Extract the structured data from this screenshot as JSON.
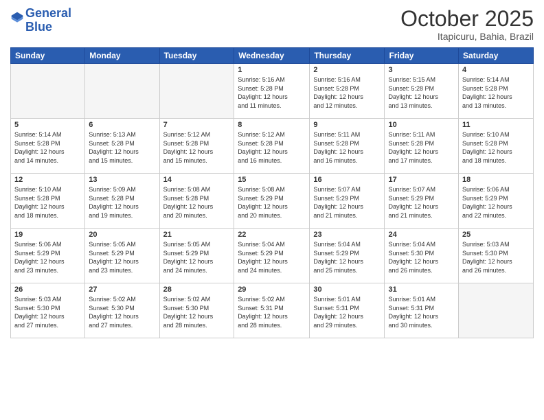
{
  "header": {
    "logo_line1": "General",
    "logo_line2": "Blue",
    "month_year": "October 2025",
    "location": "Itapicuru, Bahia, Brazil"
  },
  "weekdays": [
    "Sunday",
    "Monday",
    "Tuesday",
    "Wednesday",
    "Thursday",
    "Friday",
    "Saturday"
  ],
  "weeks": [
    [
      {
        "day": "",
        "text": ""
      },
      {
        "day": "",
        "text": ""
      },
      {
        "day": "",
        "text": ""
      },
      {
        "day": "1",
        "text": "Sunrise: 5:16 AM\nSunset: 5:28 PM\nDaylight: 12 hours\nand 11 minutes."
      },
      {
        "day": "2",
        "text": "Sunrise: 5:16 AM\nSunset: 5:28 PM\nDaylight: 12 hours\nand 12 minutes."
      },
      {
        "day": "3",
        "text": "Sunrise: 5:15 AM\nSunset: 5:28 PM\nDaylight: 12 hours\nand 13 minutes."
      },
      {
        "day": "4",
        "text": "Sunrise: 5:14 AM\nSunset: 5:28 PM\nDaylight: 12 hours\nand 13 minutes."
      }
    ],
    [
      {
        "day": "5",
        "text": "Sunrise: 5:14 AM\nSunset: 5:28 PM\nDaylight: 12 hours\nand 14 minutes."
      },
      {
        "day": "6",
        "text": "Sunrise: 5:13 AM\nSunset: 5:28 PM\nDaylight: 12 hours\nand 15 minutes."
      },
      {
        "day": "7",
        "text": "Sunrise: 5:12 AM\nSunset: 5:28 PM\nDaylight: 12 hours\nand 15 minutes."
      },
      {
        "day": "8",
        "text": "Sunrise: 5:12 AM\nSunset: 5:28 PM\nDaylight: 12 hours\nand 16 minutes."
      },
      {
        "day": "9",
        "text": "Sunrise: 5:11 AM\nSunset: 5:28 PM\nDaylight: 12 hours\nand 16 minutes."
      },
      {
        "day": "10",
        "text": "Sunrise: 5:11 AM\nSunset: 5:28 PM\nDaylight: 12 hours\nand 17 minutes."
      },
      {
        "day": "11",
        "text": "Sunrise: 5:10 AM\nSunset: 5:28 PM\nDaylight: 12 hours\nand 18 minutes."
      }
    ],
    [
      {
        "day": "12",
        "text": "Sunrise: 5:10 AM\nSunset: 5:28 PM\nDaylight: 12 hours\nand 18 minutes."
      },
      {
        "day": "13",
        "text": "Sunrise: 5:09 AM\nSunset: 5:28 PM\nDaylight: 12 hours\nand 19 minutes."
      },
      {
        "day": "14",
        "text": "Sunrise: 5:08 AM\nSunset: 5:28 PM\nDaylight: 12 hours\nand 20 minutes."
      },
      {
        "day": "15",
        "text": "Sunrise: 5:08 AM\nSunset: 5:29 PM\nDaylight: 12 hours\nand 20 minutes."
      },
      {
        "day": "16",
        "text": "Sunrise: 5:07 AM\nSunset: 5:29 PM\nDaylight: 12 hours\nand 21 minutes."
      },
      {
        "day": "17",
        "text": "Sunrise: 5:07 AM\nSunset: 5:29 PM\nDaylight: 12 hours\nand 21 minutes."
      },
      {
        "day": "18",
        "text": "Sunrise: 5:06 AM\nSunset: 5:29 PM\nDaylight: 12 hours\nand 22 minutes."
      }
    ],
    [
      {
        "day": "19",
        "text": "Sunrise: 5:06 AM\nSunset: 5:29 PM\nDaylight: 12 hours\nand 23 minutes."
      },
      {
        "day": "20",
        "text": "Sunrise: 5:05 AM\nSunset: 5:29 PM\nDaylight: 12 hours\nand 23 minutes."
      },
      {
        "day": "21",
        "text": "Sunrise: 5:05 AM\nSunset: 5:29 PM\nDaylight: 12 hours\nand 24 minutes."
      },
      {
        "day": "22",
        "text": "Sunrise: 5:04 AM\nSunset: 5:29 PM\nDaylight: 12 hours\nand 24 minutes."
      },
      {
        "day": "23",
        "text": "Sunrise: 5:04 AM\nSunset: 5:29 PM\nDaylight: 12 hours\nand 25 minutes."
      },
      {
        "day": "24",
        "text": "Sunrise: 5:04 AM\nSunset: 5:30 PM\nDaylight: 12 hours\nand 26 minutes."
      },
      {
        "day": "25",
        "text": "Sunrise: 5:03 AM\nSunset: 5:30 PM\nDaylight: 12 hours\nand 26 minutes."
      }
    ],
    [
      {
        "day": "26",
        "text": "Sunrise: 5:03 AM\nSunset: 5:30 PM\nDaylight: 12 hours\nand 27 minutes."
      },
      {
        "day": "27",
        "text": "Sunrise: 5:02 AM\nSunset: 5:30 PM\nDaylight: 12 hours\nand 27 minutes."
      },
      {
        "day": "28",
        "text": "Sunrise: 5:02 AM\nSunset: 5:30 PM\nDaylight: 12 hours\nand 28 minutes."
      },
      {
        "day": "29",
        "text": "Sunrise: 5:02 AM\nSunset: 5:31 PM\nDaylight: 12 hours\nand 28 minutes."
      },
      {
        "day": "30",
        "text": "Sunrise: 5:01 AM\nSunset: 5:31 PM\nDaylight: 12 hours\nand 29 minutes."
      },
      {
        "day": "31",
        "text": "Sunrise: 5:01 AM\nSunset: 5:31 PM\nDaylight: 12 hours\nand 30 minutes."
      },
      {
        "day": "",
        "text": ""
      }
    ]
  ]
}
